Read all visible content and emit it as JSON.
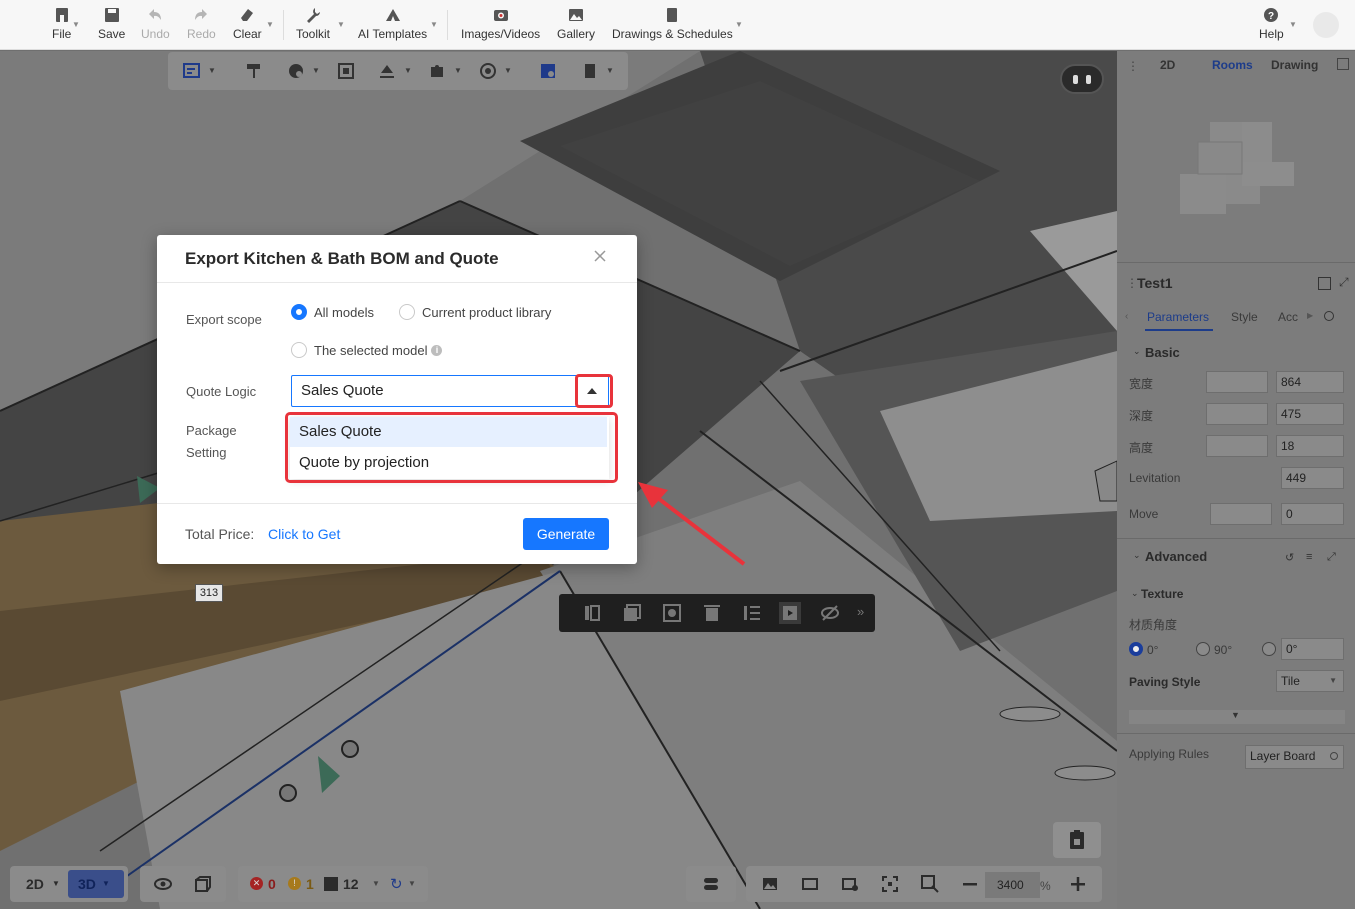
{
  "toolbar": {
    "file": "File",
    "save": "Save",
    "undo": "Undo",
    "redo": "Redo",
    "clear": "Clear",
    "toolkit": "Toolkit",
    "ai_templates": "AI Templates",
    "images_videos": "Images/Videos",
    "gallery": "Gallery",
    "drawings_schedules": "Drawings & Schedules",
    "help": "Help"
  },
  "viewport": {
    "measurement": "313"
  },
  "bottom_bar": {
    "view_2d": "2D",
    "view_3d": "3D",
    "error_count": "0",
    "warning_count": "1",
    "info_count": "12",
    "zoom_value": "3400",
    "zoom_unit": "%"
  },
  "right_panel": {
    "tabs": [
      "2D",
      "Rooms",
      "Drawing"
    ],
    "active_tab": "Rooms",
    "object_name": "Test1",
    "subtabs": [
      "Parameters",
      "Style",
      "Acc"
    ],
    "basic_label": "Basic",
    "width_label": "宽度",
    "width_value": "864",
    "depth_label": "深度",
    "depth_value": "475",
    "height_label": "高度",
    "height_value": "18",
    "levitation_label": "Levitation",
    "levitation_value": "449",
    "move_label": "Move",
    "move_value": "0",
    "advanced_label": "Advanced",
    "texture_label": "Texture",
    "material_angle_label": "材质角度",
    "angle_options": [
      "0°",
      "90°"
    ],
    "angle_input": "0°",
    "paving_style_label": "Paving Style",
    "paving_style_value": "Tile",
    "applying_rules_label": "Applying Rules",
    "applying_rules_value": "Layer Board"
  },
  "modal": {
    "title": "Export Kitchen & Bath BOM and Quote",
    "export_scope_label": "Export scope",
    "scope_options": {
      "all_models": "All models",
      "current_library": "Current product library",
      "selected_model": "The selected model"
    },
    "selected_scope": "All models",
    "quote_logic_label": "Quote Logic",
    "quote_logic_value": "Sales Quote",
    "quote_logic_options": [
      "Sales Quote",
      "Quote by projection"
    ],
    "package_label_line1": "Package",
    "package_label_line2": "Setting",
    "total_price_label": "Total Price:",
    "total_price_link": "Click to Get",
    "generate_button": "Generate"
  },
  "colors": {
    "accent": "#1677ff",
    "annotation_red": "#e8333b",
    "dropdown_selected_bg": "#e6f0ff"
  }
}
